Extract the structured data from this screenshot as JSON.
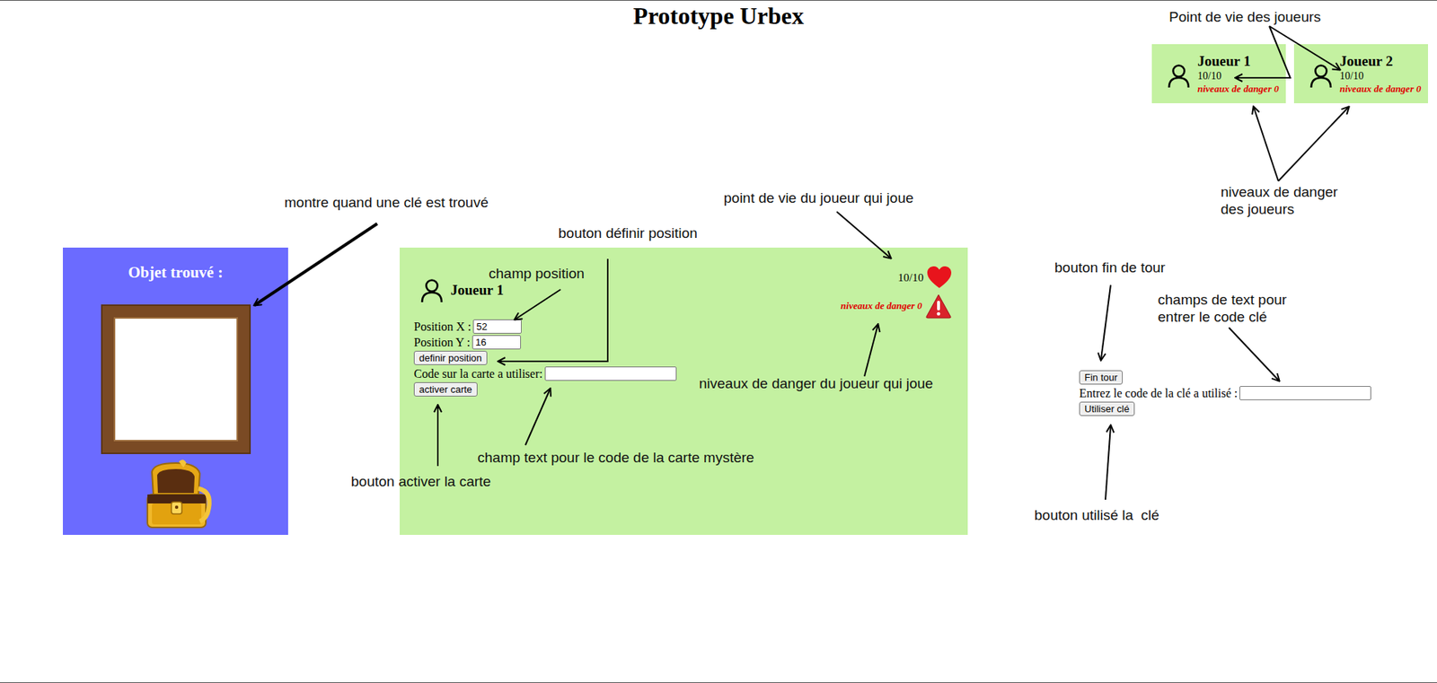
{
  "title": "Prototype Urbex",
  "players": [
    {
      "name": "Joueur 1",
      "hp": "10/10",
      "danger": "niveaux de danger 0"
    },
    {
      "name": "Joueur 2",
      "hp": "10/10",
      "danger": "niveaux de danger 0"
    }
  ],
  "found_panel": {
    "title": "Objet trouvé :"
  },
  "current_player": {
    "name": "Joueur 1",
    "hp": "10/10",
    "danger": "niveaux de danger 0",
    "fields": [
      {
        "label": "Position X :",
        "value": "52"
      },
      {
        "label": "Position Y :",
        "value": "16"
      }
    ],
    "position_button": "definir position",
    "card_code": {
      "label": "Code sur la carte a utiliser:",
      "value": ""
    },
    "activate_button": "activer carte"
  },
  "turn_controls": {
    "end_turn_button": "Fin tour",
    "key_label": "Entrez le code de la clé a utilisé :",
    "key_value": "",
    "use_key_button": "Utiliser clé"
  },
  "annotations": [
    {
      "text": "Point de vie des joueurs"
    },
    {
      "text": "niveaux de danger\ndes joueurs"
    },
    {
      "text": "montre quand une clé est trouvé"
    },
    {
      "text": "point de vie du joueur qui joue"
    },
    {
      "text": "bouton définir position"
    },
    {
      "text": "champ position"
    },
    {
      "text": "niveaux de danger du joueur qui joue"
    },
    {
      "text": "champ text pour le code de la carte mystère"
    },
    {
      "text": "bouton activer la carte"
    },
    {
      "text": "bouton fin de tour"
    },
    {
      "text": "champs de text pour\nentrer le code clé"
    },
    {
      "text": "bouton utilisé la  clé"
    }
  ]
}
